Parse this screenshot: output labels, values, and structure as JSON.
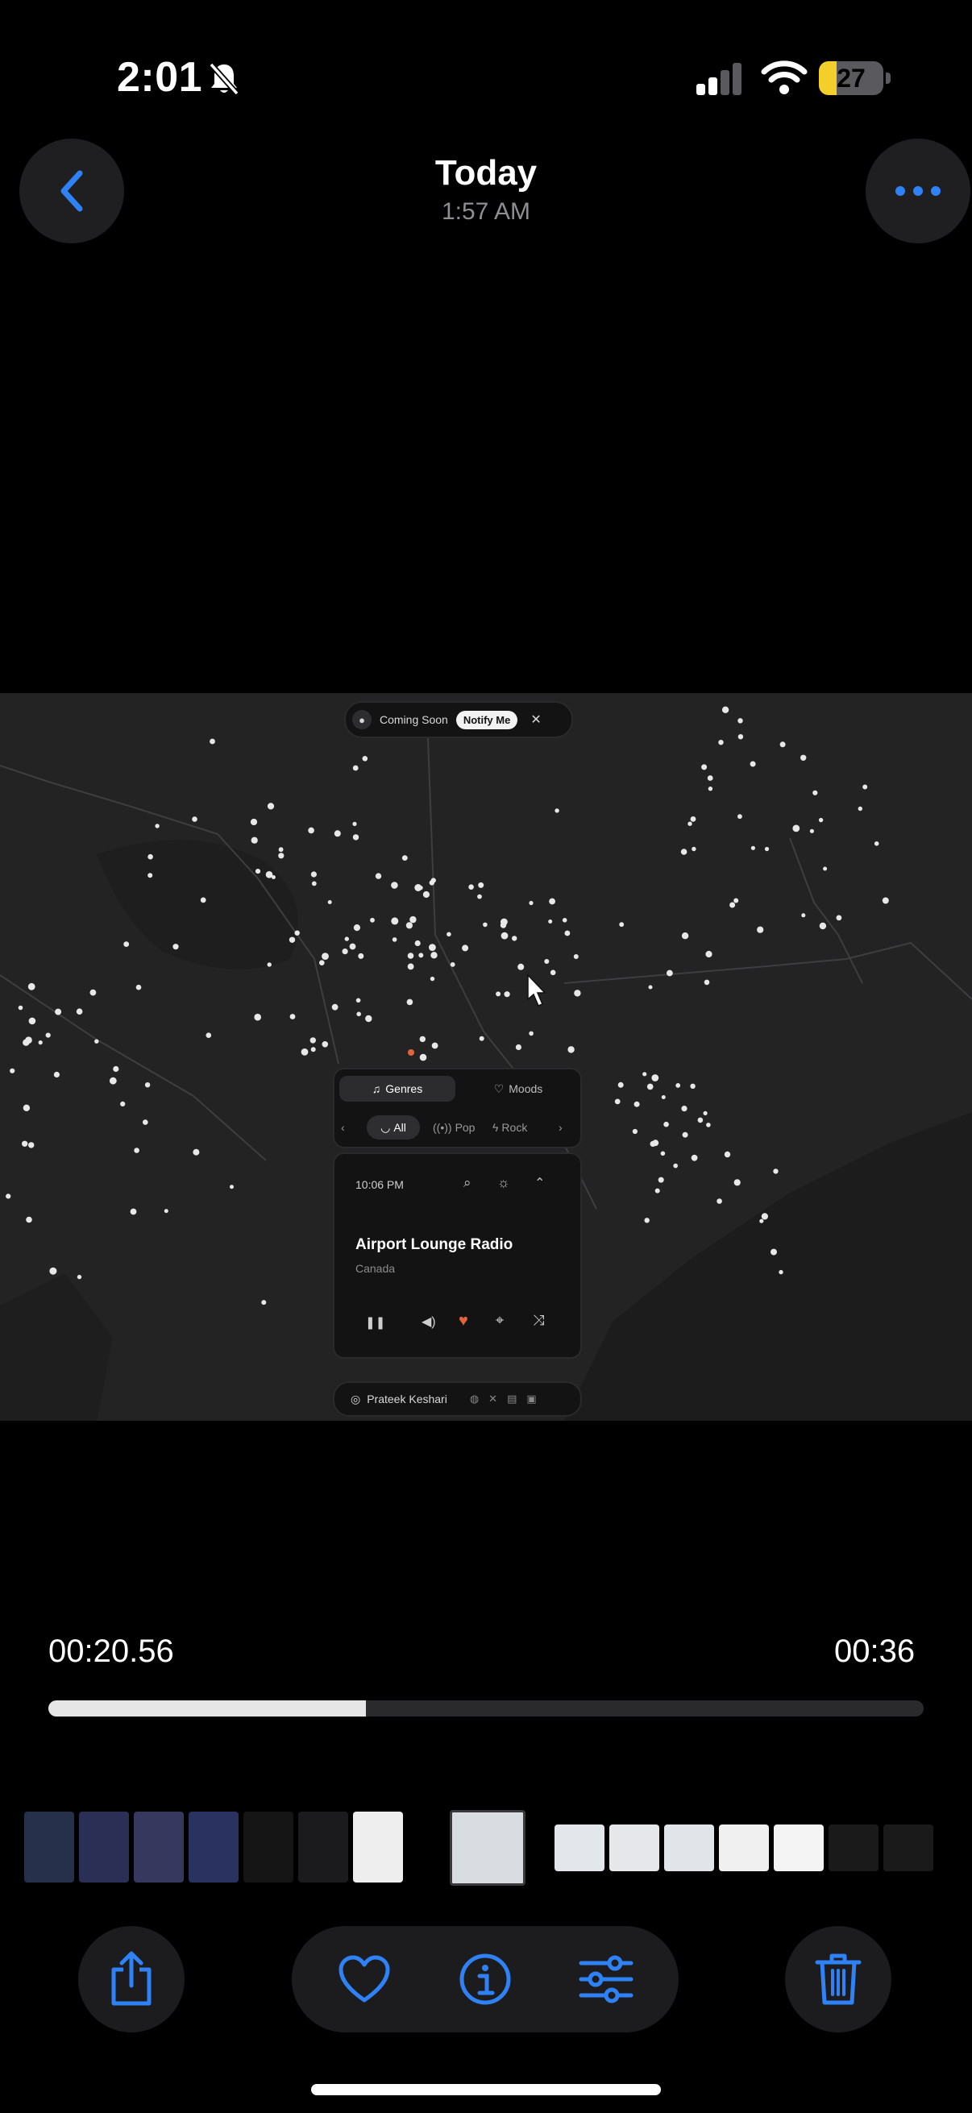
{
  "status_bar": {
    "time": "2:01",
    "battery": "27",
    "battery_level": 0.27
  },
  "nav": {
    "title": "Today",
    "subtitle": "1:57 AM"
  },
  "video": {
    "coming_soon": "Coming Soon",
    "notify_me": "Notify Me",
    "tabs": [
      {
        "label": "Genres"
      },
      {
        "label": "Moods"
      }
    ],
    "genre_chips": [
      {
        "label": "All"
      },
      {
        "label": "Pop"
      },
      {
        "label": "Rock"
      }
    ],
    "player": {
      "time": "10:06 PM",
      "station": "Airport Lounge Radio",
      "country": "Canada"
    },
    "footer": {
      "author": "Prateek Keshari"
    }
  },
  "playback": {
    "elapsed": "00:20.56",
    "duration": "00:36",
    "progress": 0.363
  },
  "colors": {
    "accent": "#2f82f5",
    "heart": "#e2643e",
    "battery_fill": "#f4cf2a"
  },
  "icons": [
    "bell-slash-icon",
    "signal-icon",
    "wifi-icon",
    "chevron-left-icon",
    "ellipsis-icon",
    "share-icon",
    "heart-icon",
    "info-icon",
    "adjust-icon",
    "trash-icon"
  ]
}
